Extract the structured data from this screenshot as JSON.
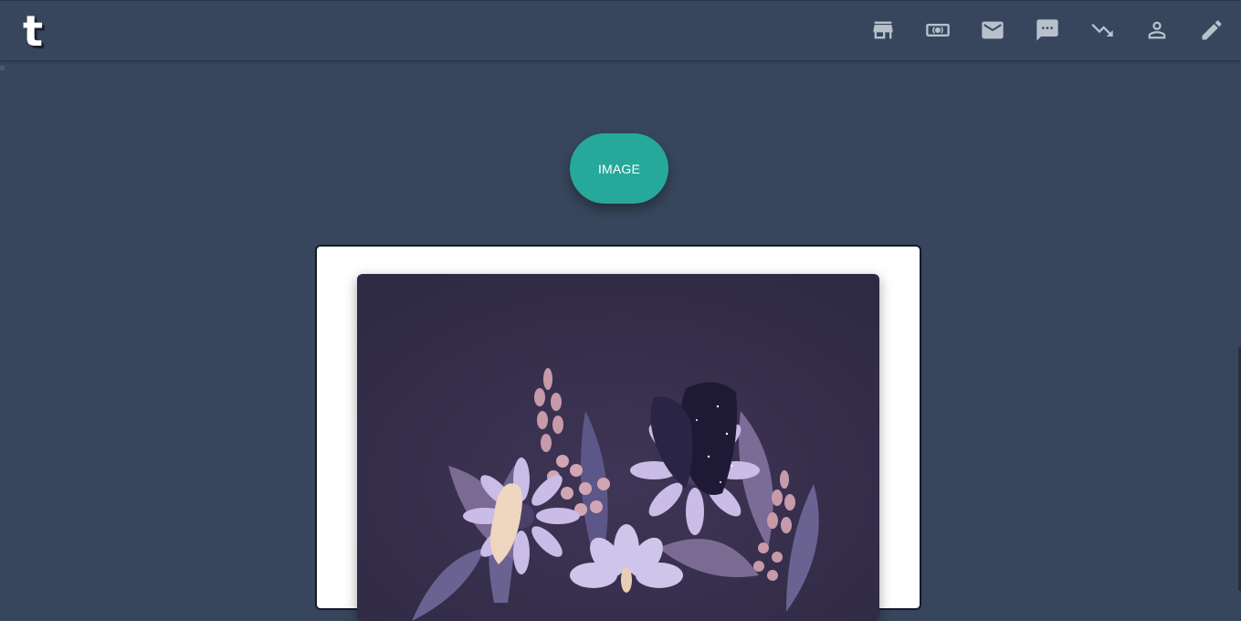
{
  "header": {
    "logo_letter": "t",
    "icons": [
      "store-icon",
      "live-video-icon",
      "mail-icon",
      "chat-icon",
      "trending-icon",
      "account-icon",
      "edit-icon"
    ]
  },
  "main": {
    "post_type_button_label": "IMAGE"
  },
  "colors": {
    "background": "#37465c",
    "accent": "#26a89b",
    "card": "#ffffff"
  }
}
